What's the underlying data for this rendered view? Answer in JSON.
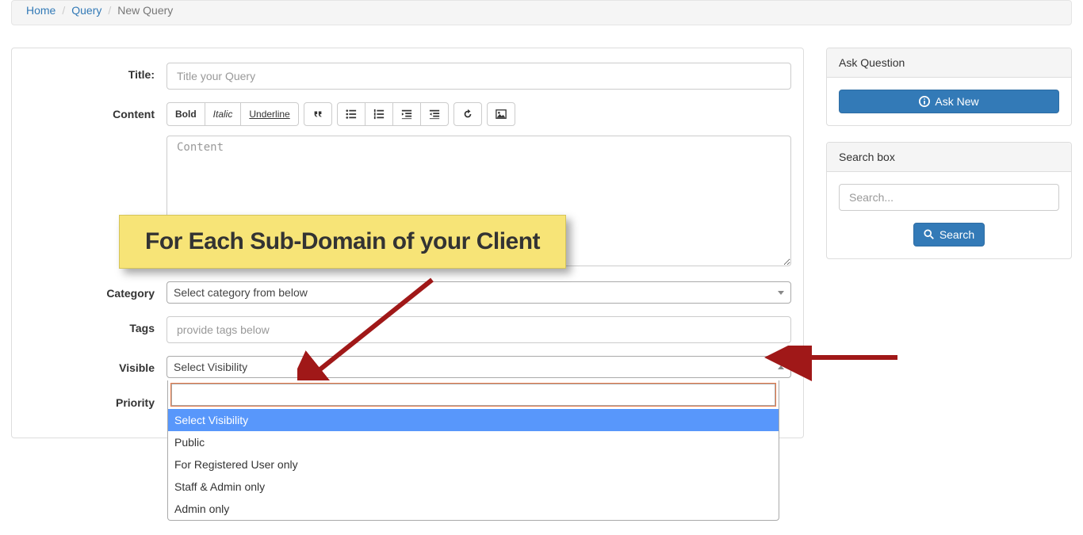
{
  "breadcrumb": {
    "home": "Home",
    "query": "Query",
    "current": "New Query"
  },
  "form": {
    "title_label": "Title:",
    "title_placeholder": "Title your Query",
    "content_label": "Content",
    "content_placeholder": "Content",
    "category_label": "Category",
    "category_placeholder": "Select category from below",
    "tags_label": "Tags",
    "tags_placeholder": "provide tags below",
    "visible_label": "Visible",
    "visible_placeholder": "Select Visibility",
    "priority_label": "Priority"
  },
  "toolbar": {
    "bold": "Bold",
    "italic": "Italic",
    "underline": "Underline"
  },
  "visibility": {
    "options": [
      "Select Visibility",
      "Public",
      "For Registered User only",
      "Staff & Admin only",
      "Admin only"
    ]
  },
  "callout": "For Each Sub-Domain of your Client",
  "sidebar": {
    "ask_heading": "Ask Question",
    "ask_button": "Ask New",
    "search_heading": "Search box",
    "search_placeholder": "Search...",
    "search_button": "Search"
  }
}
